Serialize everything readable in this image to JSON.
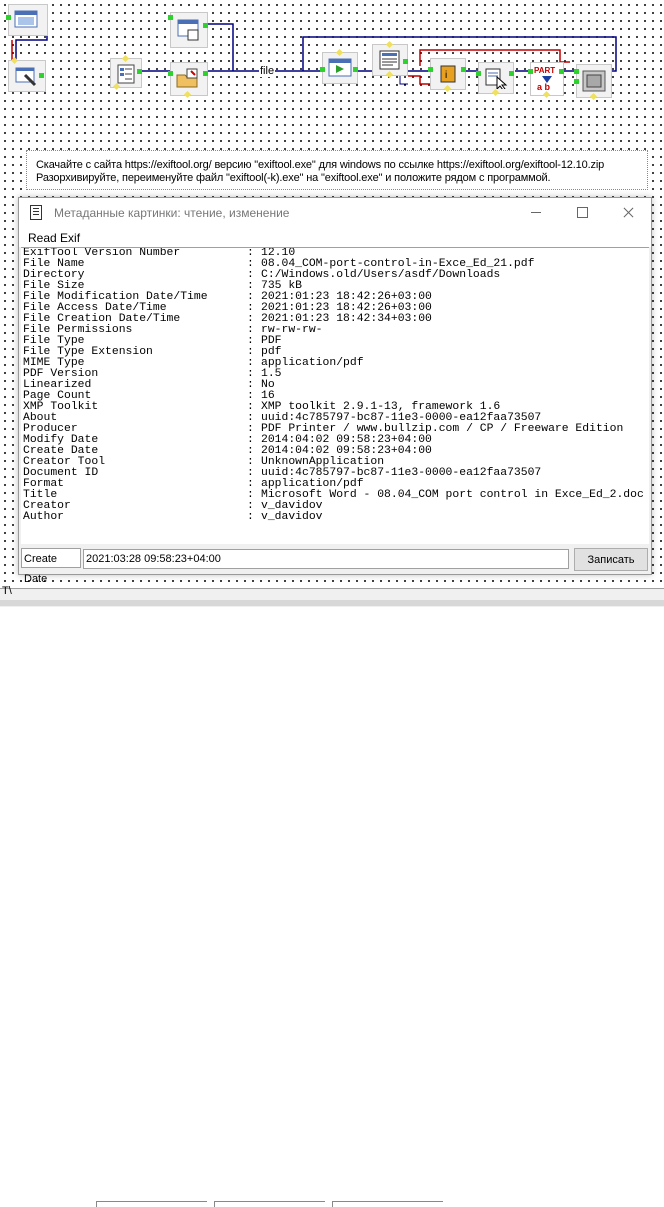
{
  "canvas": {
    "wire_label": "file",
    "note_lines": [
      "Скачайте с сайта https://exiftool.org/ версию \"exiftool.exe\" для windows по ссылке https://exiftool.org/exiftool-12.10.zip",
      "Разорхивируйте, переименуйте файл \"exiftool(-k).exe\" на \"exiftool.exe\" и положите рядом с программой."
    ],
    "part_label": "PART",
    "part_sub": "a b"
  },
  "window": {
    "title": "Метаданные картинки: чтение, изменение",
    "menu_read": "Read Exif",
    "exif": [
      {
        "key": "ExifTool Version Number",
        "value": "12.10"
      },
      {
        "key": "File Name",
        "value": "08.04_COM-port-control-in-Exce_Ed_21.pdf"
      },
      {
        "key": "Directory",
        "value": "C:/Windows.old/Users/asdf/Downloads"
      },
      {
        "key": "File Size",
        "value": "735 kB"
      },
      {
        "key": "File Modification Date/Time",
        "value": "2021:01:23 18:42:26+03:00"
      },
      {
        "key": "File Access Date/Time",
        "value": "2021:01:23 18:42:26+03:00"
      },
      {
        "key": "File Creation Date/Time",
        "value": "2021:01:23 18:42:34+03:00"
      },
      {
        "key": "File Permissions",
        "value": "rw-rw-rw-"
      },
      {
        "key": "File Type",
        "value": "PDF"
      },
      {
        "key": "File Type Extension",
        "value": "pdf"
      },
      {
        "key": "MIME Type",
        "value": "application/pdf"
      },
      {
        "key": "PDF Version",
        "value": "1.5"
      },
      {
        "key": "Linearized",
        "value": "No"
      },
      {
        "key": "Page Count",
        "value": "16"
      },
      {
        "key": "XMP Toolkit",
        "value": "XMP toolkit 2.9.1-13, framework 1.6"
      },
      {
        "key": "About",
        "value": "uuid:4c785797-bc87-11e3-0000-ea12faa73507"
      },
      {
        "key": "Producer",
        "value": "PDF Printer / www.bullzip.com / CP / Freeware Edition"
      },
      {
        "key": "Modify Date",
        "value": "2014:04:02 09:58:23+04:00"
      },
      {
        "key": "Create Date",
        "value": "2014:04:02 09:58:23+04:00"
      },
      {
        "key": "Creator Tool",
        "value": "UnknownApplication"
      },
      {
        "key": "Document ID",
        "value": "uuid:4c785797-bc87-11e3-0000-ea12faa73507"
      },
      {
        "key": "Format",
        "value": "application/pdf"
      },
      {
        "key": "Title",
        "value": "Microsoft Word - 08.04_COM port control in Exce_Ed_2.doc"
      },
      {
        "key": "Creator",
        "value": "v_davidov"
      },
      {
        "key": "Author",
        "value": "v_davidov"
      }
    ],
    "separator": ":",
    "create_date_label": "Create Date",
    "create_date_value": "2021:03:28 09:58:23+04:00",
    "save_label": "Записать"
  },
  "status": {
    "text": "T\\"
  }
}
